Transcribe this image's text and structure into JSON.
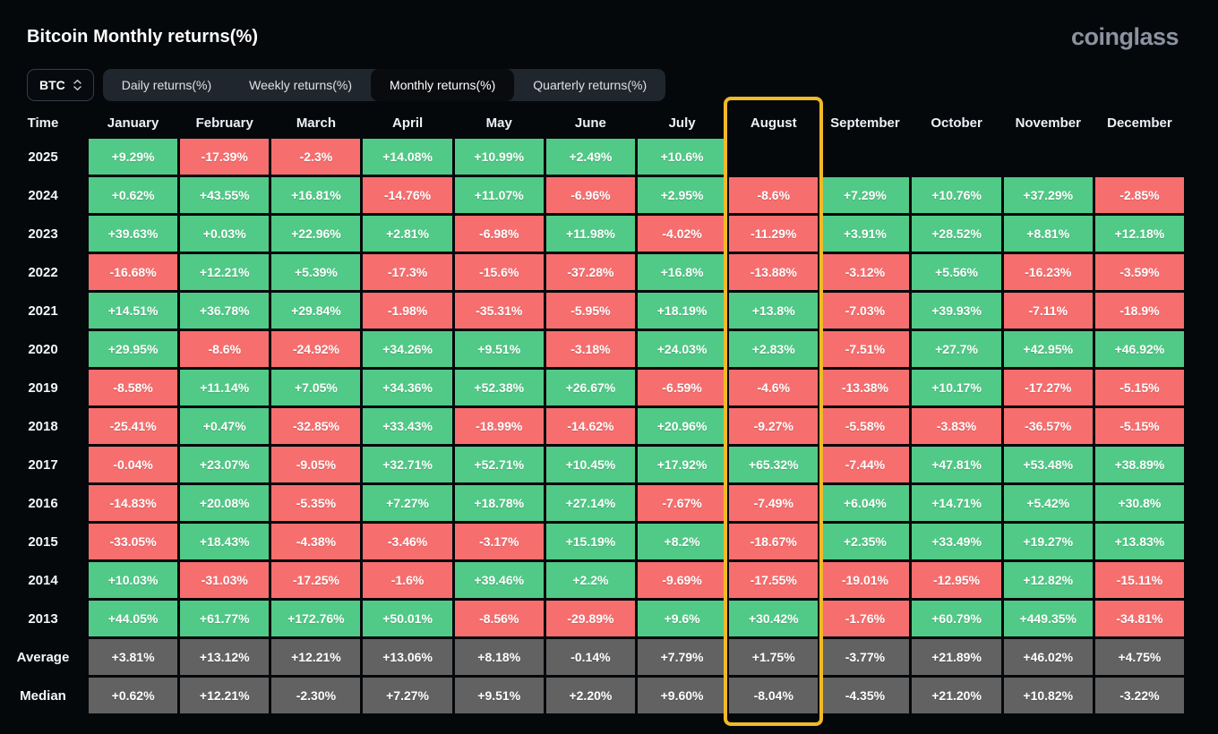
{
  "page": {
    "title": "Bitcoin Monthly returns(%)",
    "brand": "coinglass"
  },
  "controls": {
    "symbol_select": {
      "value": "BTC"
    },
    "tabs": [
      {
        "label": "Daily returns(%)",
        "active": false
      },
      {
        "label": "Weekly returns(%)",
        "active": false
      },
      {
        "label": "Monthly returns(%)",
        "active": true
      },
      {
        "label": "Quarterly returns(%)",
        "active": false
      }
    ]
  },
  "colors": {
    "positive": "#51c987",
    "negative": "#f76e6e",
    "summary": "#626262",
    "highlight_border": "#f0b928",
    "background": "#05080b"
  },
  "chart_data": {
    "type": "heatmap",
    "title": "Bitcoin Monthly returns(%)",
    "time_header": "Time",
    "columns": [
      "January",
      "February",
      "March",
      "April",
      "May",
      "June",
      "July",
      "August",
      "September",
      "October",
      "November",
      "December"
    ],
    "highlighted_column": "August",
    "cell_color_rule": "positive values green, negative values red, summary rows gray, null cells empty",
    "rows": [
      {
        "label": "2025",
        "type": "year",
        "values": [
          "+9.29%",
          "-17.39%",
          "-2.3%",
          "+14.08%",
          "+10.99%",
          "+2.49%",
          "+10.6%",
          null,
          null,
          null,
          null,
          null
        ]
      },
      {
        "label": "2024",
        "type": "year",
        "values": [
          "+0.62%",
          "+43.55%",
          "+16.81%",
          "-14.76%",
          "+11.07%",
          "-6.96%",
          "+2.95%",
          "-8.6%",
          "+7.29%",
          "+10.76%",
          "+37.29%",
          "-2.85%"
        ]
      },
      {
        "label": "2023",
        "type": "year",
        "values": [
          "+39.63%",
          "+0.03%",
          "+22.96%",
          "+2.81%",
          "-6.98%",
          "+11.98%",
          "-4.02%",
          "-11.29%",
          "+3.91%",
          "+28.52%",
          "+8.81%",
          "+12.18%"
        ]
      },
      {
        "label": "2022",
        "type": "year",
        "values": [
          "-16.68%",
          "+12.21%",
          "+5.39%",
          "-17.3%",
          "-15.6%",
          "-37.28%",
          "+16.8%",
          "-13.88%",
          "-3.12%",
          "+5.56%",
          "-16.23%",
          "-3.59%"
        ]
      },
      {
        "label": "2021",
        "type": "year",
        "values": [
          "+14.51%",
          "+36.78%",
          "+29.84%",
          "-1.98%",
          "-35.31%",
          "-5.95%",
          "+18.19%",
          "+13.8%",
          "-7.03%",
          "+39.93%",
          "-7.11%",
          "-18.9%"
        ]
      },
      {
        "label": "2020",
        "type": "year",
        "values": [
          "+29.95%",
          "-8.6%",
          "-24.92%",
          "+34.26%",
          "+9.51%",
          "-3.18%",
          "+24.03%",
          "+2.83%",
          "-7.51%",
          "+27.7%",
          "+42.95%",
          "+46.92%"
        ]
      },
      {
        "label": "2019",
        "type": "year",
        "values": [
          "-8.58%",
          "+11.14%",
          "+7.05%",
          "+34.36%",
          "+52.38%",
          "+26.67%",
          "-6.59%",
          "-4.6%",
          "-13.38%",
          "+10.17%",
          "-17.27%",
          "-5.15%"
        ]
      },
      {
        "label": "2018",
        "type": "year",
        "values": [
          "-25.41%",
          "+0.47%",
          "-32.85%",
          "+33.43%",
          "-18.99%",
          "-14.62%",
          "+20.96%",
          "-9.27%",
          "-5.58%",
          "-3.83%",
          "-36.57%",
          "-5.15%"
        ]
      },
      {
        "label": "2017",
        "type": "year",
        "values": [
          "-0.04%",
          "+23.07%",
          "-9.05%",
          "+32.71%",
          "+52.71%",
          "+10.45%",
          "+17.92%",
          "+65.32%",
          "-7.44%",
          "+47.81%",
          "+53.48%",
          "+38.89%"
        ]
      },
      {
        "label": "2016",
        "type": "year",
        "values": [
          "-14.83%",
          "+20.08%",
          "-5.35%",
          "+7.27%",
          "+18.78%",
          "+27.14%",
          "-7.67%",
          "-7.49%",
          "+6.04%",
          "+14.71%",
          "+5.42%",
          "+30.8%"
        ]
      },
      {
        "label": "2015",
        "type": "year",
        "values": [
          "-33.05%",
          "+18.43%",
          "-4.38%",
          "-3.46%",
          "-3.17%",
          "+15.19%",
          "+8.2%",
          "-18.67%",
          "+2.35%",
          "+33.49%",
          "+19.27%",
          "+13.83%"
        ]
      },
      {
        "label": "2014",
        "type": "year",
        "values": [
          "+10.03%",
          "-31.03%",
          "-17.25%",
          "-1.6%",
          "+39.46%",
          "+2.2%",
          "-9.69%",
          "-17.55%",
          "-19.01%",
          "-12.95%",
          "+12.82%",
          "-15.11%"
        ]
      },
      {
        "label": "2013",
        "type": "year",
        "values": [
          "+44.05%",
          "+61.77%",
          "+172.76%",
          "+50.01%",
          "-8.56%",
          "-29.89%",
          "+9.6%",
          "+30.42%",
          "-1.76%",
          "+60.79%",
          "+449.35%",
          "-34.81%"
        ]
      },
      {
        "label": "Average",
        "type": "summary",
        "values": [
          "+3.81%",
          "+13.12%",
          "+12.21%",
          "+13.06%",
          "+8.18%",
          "-0.14%",
          "+7.79%",
          "+1.75%",
          "-3.77%",
          "+21.89%",
          "+46.02%",
          "+4.75%"
        ]
      },
      {
        "label": "Median",
        "type": "summary",
        "values": [
          "+0.62%",
          "+12.21%",
          "-2.30%",
          "+7.27%",
          "+9.51%",
          "+2.20%",
          "+9.60%",
          "-8.04%",
          "-4.35%",
          "+21.20%",
          "+10.82%",
          "-3.22%"
        ]
      }
    ]
  }
}
